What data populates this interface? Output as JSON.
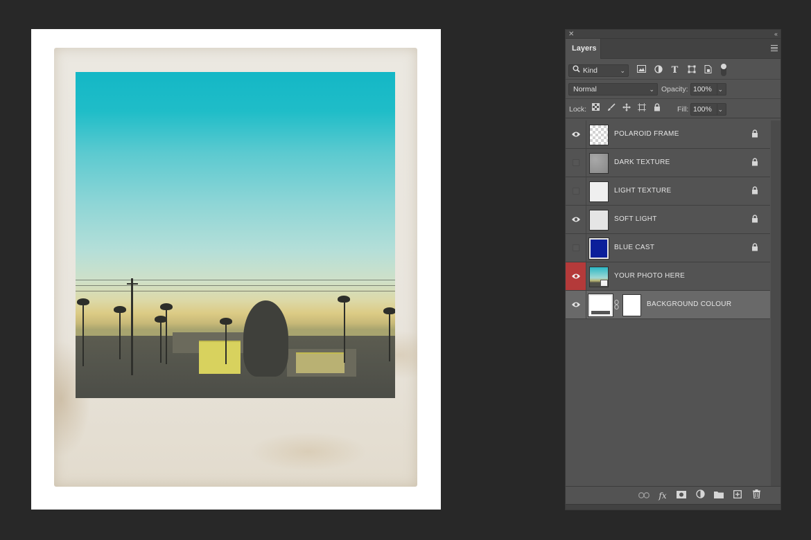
{
  "panel": {
    "tab_label": "Layers",
    "kind_filter": "Kind",
    "blend_mode": "Normal",
    "opacity_label": "Opacity:",
    "opacity_value": "100%",
    "lock_label": "Lock:",
    "fill_label": "Fill:",
    "fill_value": "100%"
  },
  "layers": [
    {
      "name": "POLAROID FRAME",
      "visible": true,
      "locked": true
    },
    {
      "name": "DARK TEXTURE",
      "visible": false,
      "locked": true
    },
    {
      "name": "LIGHT TEXTURE",
      "visible": false,
      "locked": true
    },
    {
      "name": "SOFT LIGHT",
      "visible": true,
      "locked": true
    },
    {
      "name": "BLUE CAST",
      "visible": false,
      "locked": true,
      "thumb_color": "#0b1f9a"
    },
    {
      "name": "YOUR PHOTO HERE",
      "visible": true,
      "locked": false,
      "highlight_color": "#b43a3a"
    },
    {
      "name": "BACKGROUND COLOUR",
      "visible": true,
      "locked": false,
      "selected": true
    }
  ],
  "colors": {
    "app_background": "#282828",
    "panel_background": "#535353",
    "selected_row": "#696969",
    "sky_top": "#14b7c6",
    "sunset": "#dccb85"
  }
}
